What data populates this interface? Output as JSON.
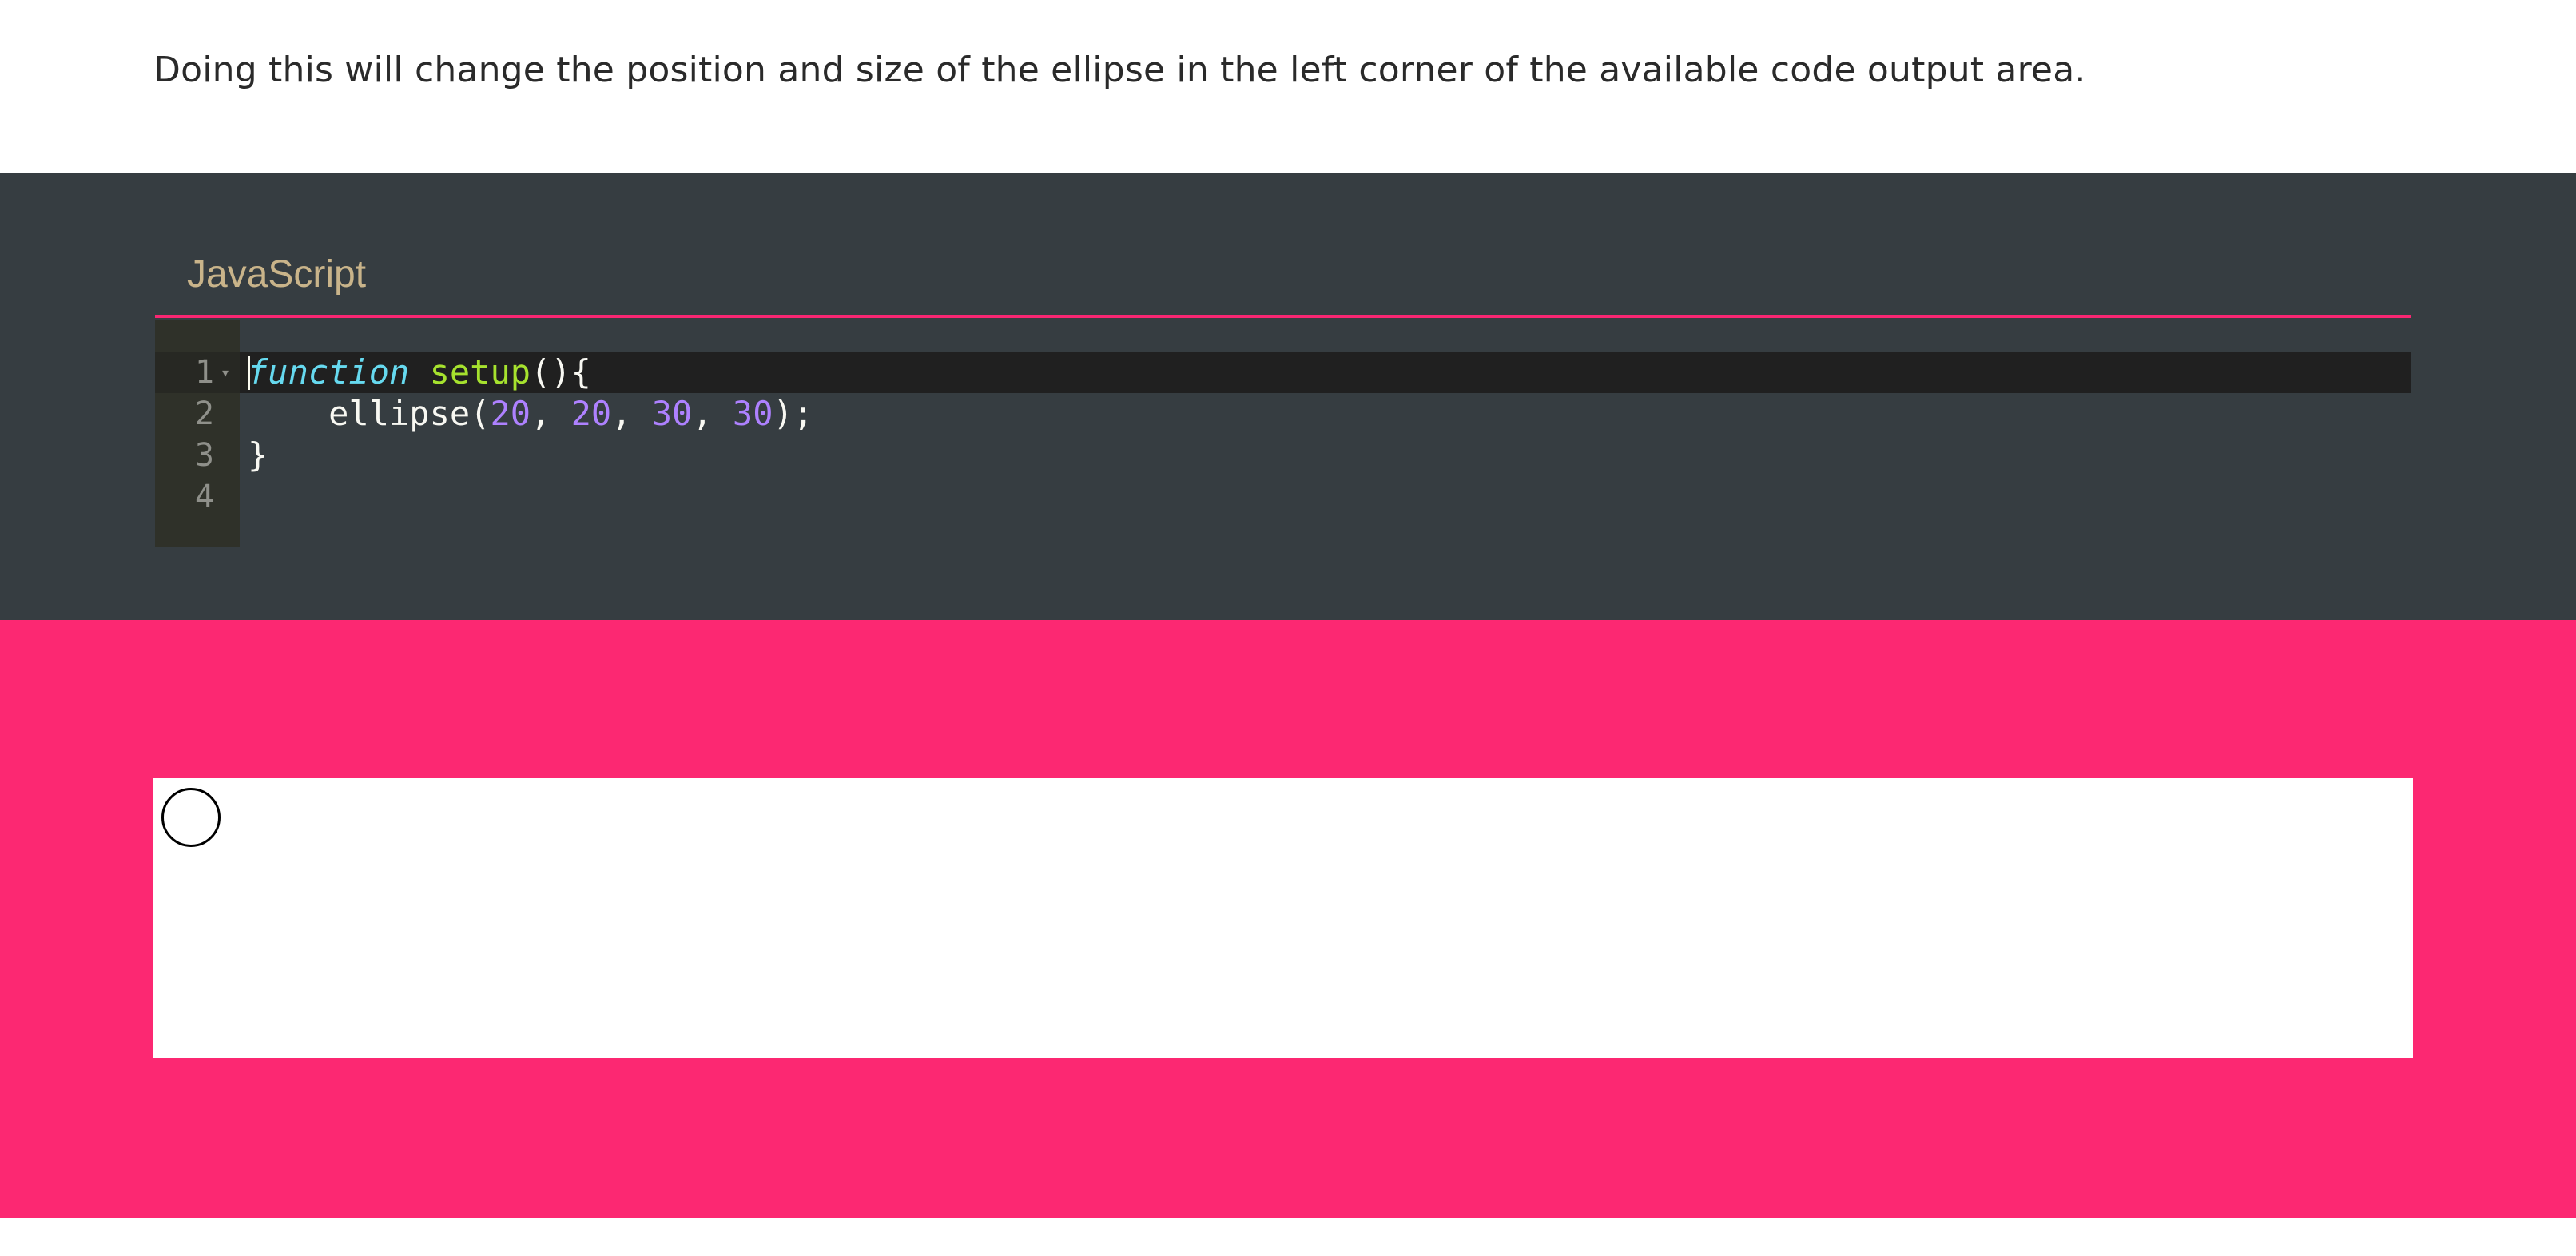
{
  "intro_text": "Doing this will change the position and size of the ellipse in the left corner of the available code output area.",
  "editor": {
    "language_label": "JavaScript",
    "line_numbers": [
      "1",
      "2",
      "3",
      "4"
    ],
    "code": {
      "line1": {
        "keyword": "function",
        "name": "setup",
        "rest": "(){"
      },
      "line2": {
        "indent": "    ",
        "call": "ellipse(",
        "args": [
          "20",
          "20",
          "30",
          "30"
        ],
        "sep": ", ",
        "end": ");"
      },
      "line3": "}",
      "line4": ""
    }
  },
  "colors": {
    "editor_bg": "#363d41",
    "accent_pink": "#fc2872",
    "keyword": "#66d9ef",
    "function_name": "#a6e22e",
    "number": "#ae81ff",
    "label": "#c9b48a"
  },
  "output": {
    "shape": "ellipse",
    "ellipse": {
      "x": 20,
      "y": 20,
      "w": 30,
      "h": 30
    }
  }
}
